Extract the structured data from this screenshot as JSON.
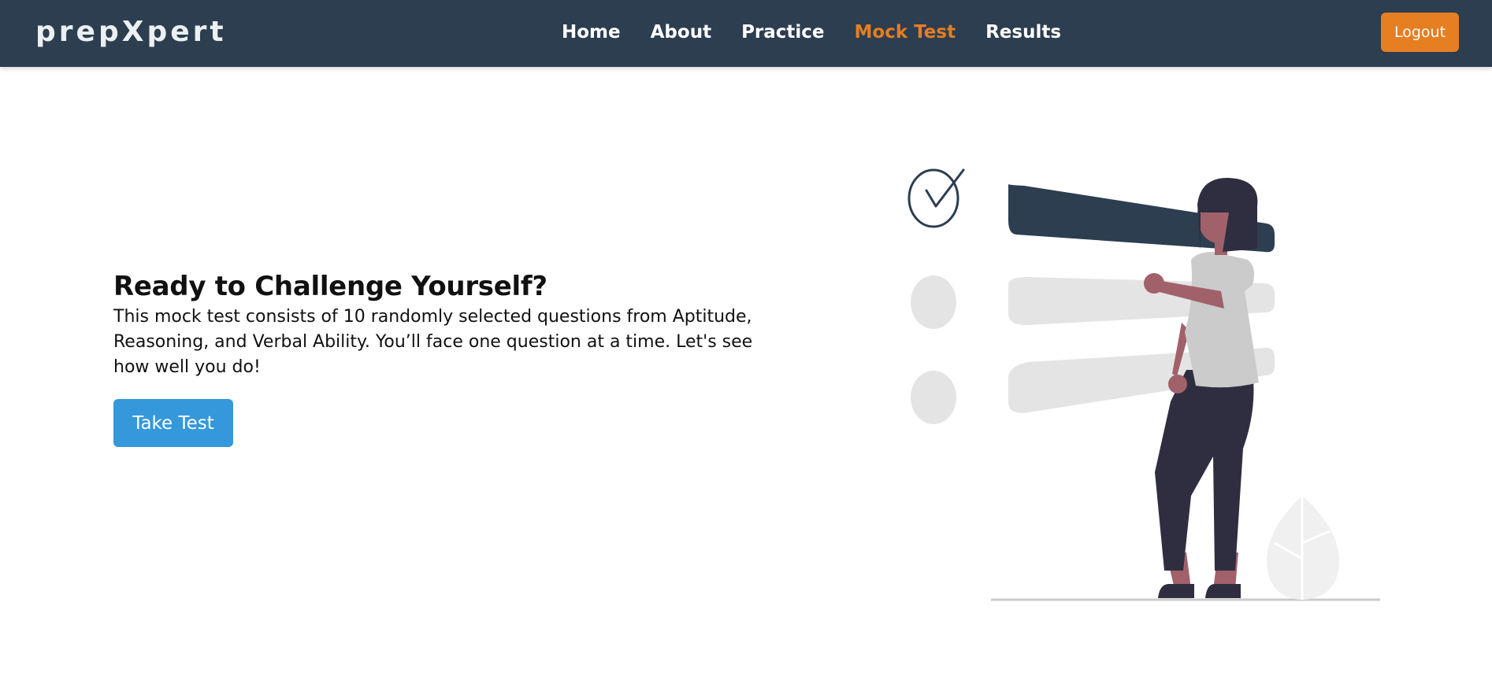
{
  "brand": {
    "name": "prepXpert"
  },
  "nav": {
    "items": [
      {
        "label": "Home",
        "active": false
      },
      {
        "label": "About",
        "active": false
      },
      {
        "label": "Practice",
        "active": false
      },
      {
        "label": "Mock Test",
        "active": true
      },
      {
        "label": "Results",
        "active": false
      }
    ],
    "logout_label": "Logout"
  },
  "hero": {
    "title": "Ready to Challenge Yourself?",
    "description": "This mock test consists of 10 randomly selected questions from Aptitude, Reasoning, and Verbal Ability. You’ll face one question at a time. Let's see how well you do!",
    "button_label": "Take Test"
  },
  "illustration": {
    "icon": "checklist-person-illustration",
    "colors": {
      "accent": "#2c3e50",
      "muted": "#e4e4e4",
      "skin": "#a0616a",
      "hair": "#2f2e41",
      "shirt": "#cbcbcb",
      "pants": "#2f2e41",
      "leaf": "#f0f0f0"
    }
  },
  "theme": {
    "navbar_bg": "#2c3e50",
    "accent_orange": "#e67e22",
    "primary_blue": "#3498db"
  }
}
